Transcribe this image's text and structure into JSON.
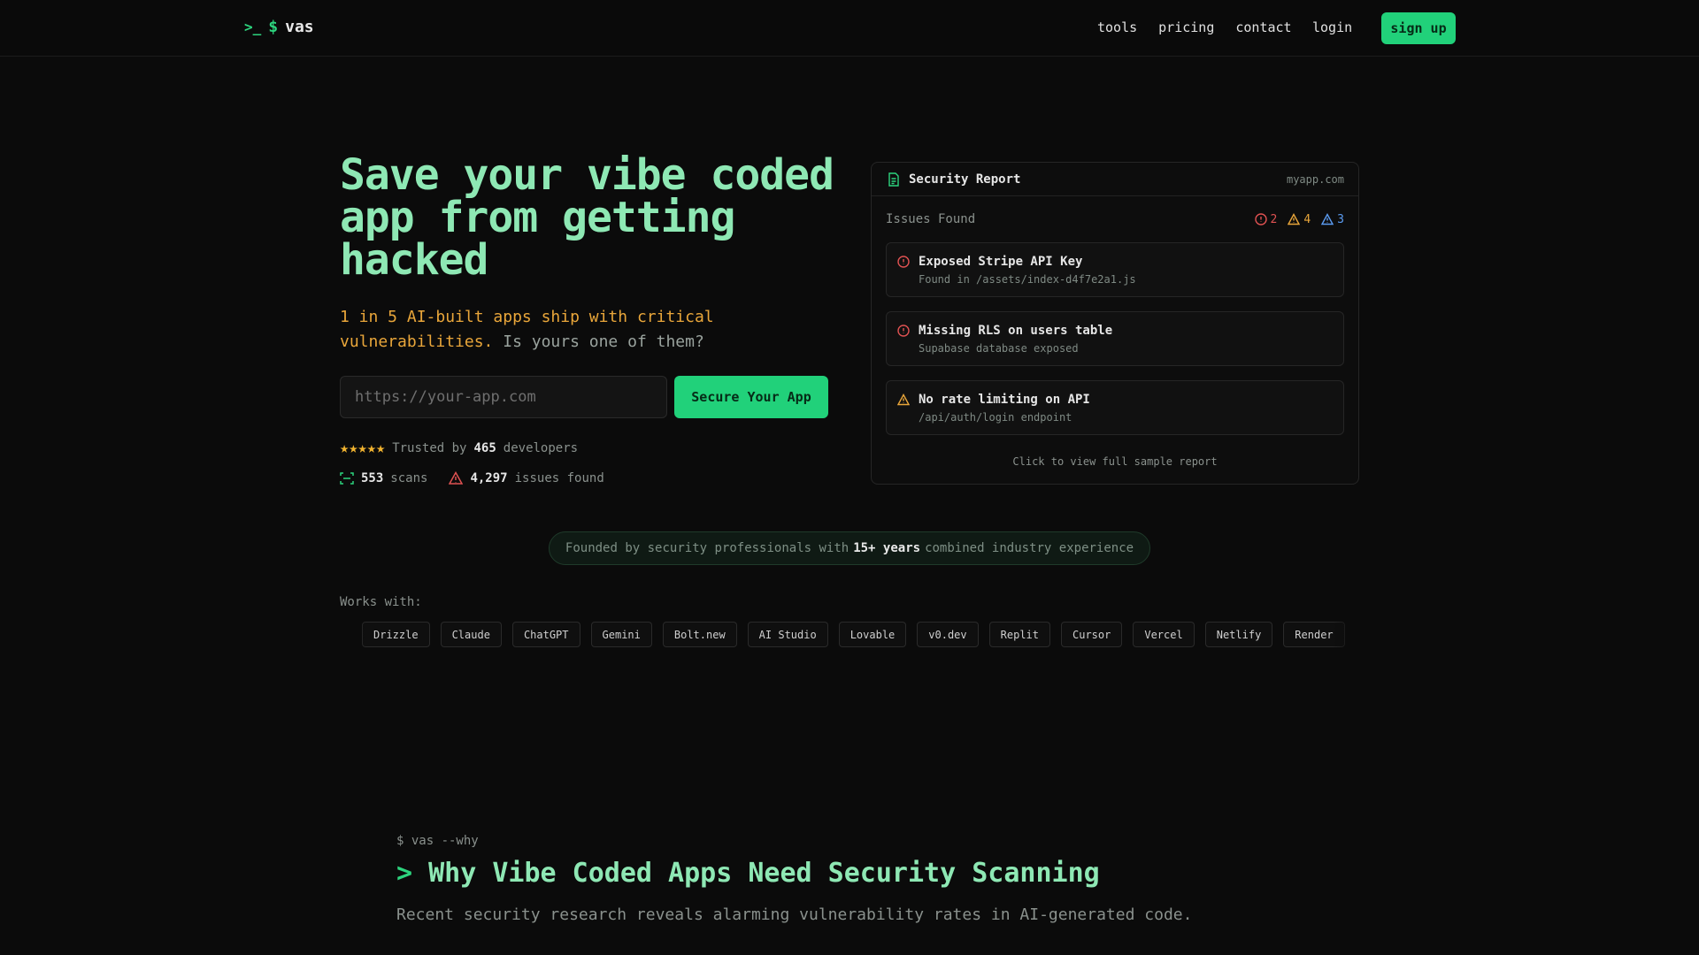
{
  "nav": {
    "prompt_symbol": ">_",
    "dollar": "$",
    "brand": "vas",
    "links": [
      "tools",
      "pricing",
      "contact"
    ],
    "login": "login",
    "signup": "sign up"
  },
  "hero": {
    "title": "Save your vibe coded app from getting hacked",
    "sub_warn": "1 in 5 AI-built apps ship with critical vulnerabilities.",
    "sub_muted": " Is yours one of them?",
    "input_placeholder": "https://your-app.com",
    "cta": "Secure Your App",
    "stars": "★★★★★",
    "trusted_prefix": "Trusted by",
    "trusted_count": "465",
    "trusted_suffix": "developers",
    "scans_count": "553",
    "scans_label": "scans",
    "issues_count": "4,297",
    "issues_label": "issues found"
  },
  "report": {
    "title": "Security Report",
    "site": "myapp.com",
    "issues_label": "Issues Found",
    "critical": "2",
    "warning": "4",
    "info": "3",
    "items": [
      {
        "title": "Exposed Stripe API Key",
        "detail": "Found in /assets/index-d4f7e2a1.js",
        "severity": "critical"
      },
      {
        "title": "Missing RLS on users table",
        "detail": "Supabase database exposed",
        "severity": "critical"
      },
      {
        "title": "No rate limiting on API",
        "detail": "/api/auth/login endpoint",
        "severity": "warning"
      }
    ],
    "footer": "Click to view full sample report"
  },
  "founded": {
    "prefix": "Founded by security professionals with",
    "highlight": "15+ years",
    "suffix": "combined industry experience"
  },
  "works_with": {
    "label": "Works with:",
    "tools": [
      "Drizzle",
      "Claude",
      "ChatGPT",
      "Gemini",
      "Bolt.new",
      "AI Studio",
      "Lovable",
      "v0.dev",
      "Replit",
      "Cursor",
      "Vercel",
      "Netlify",
      "Render"
    ]
  },
  "why": {
    "command": "$ vas --why",
    "gt": ">",
    "title": "Why Vibe Coded Apps Need Security Scanning",
    "description": "Recent security research reveals alarming vulnerability rates in AI-generated code."
  },
  "colors": {
    "accent": "#21d17a",
    "title_green": "#8ee8b4",
    "warn": "#e9a63a",
    "critical": "#e05252",
    "info": "#5b9bf0"
  }
}
